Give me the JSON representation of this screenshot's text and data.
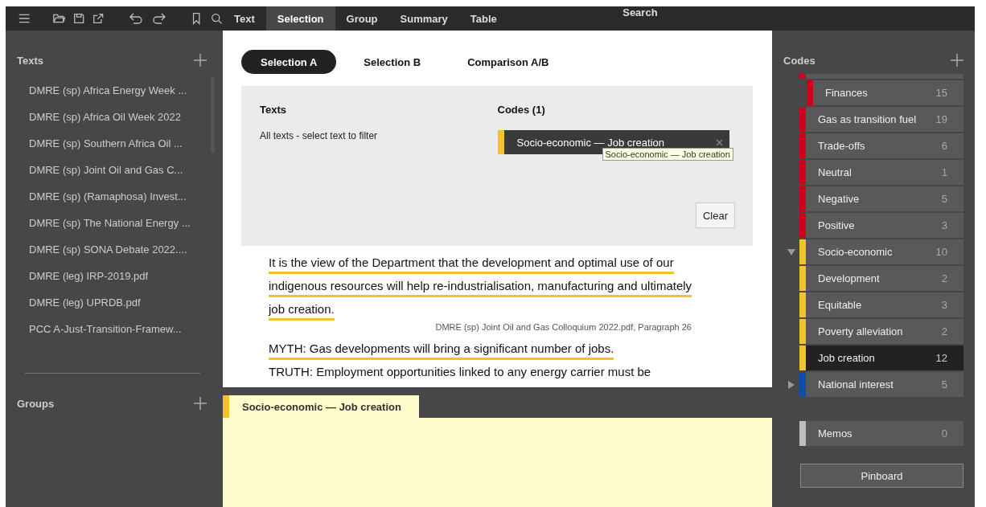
{
  "toolbar": {
    "tabs": [
      {
        "label": "Text",
        "selected": false
      },
      {
        "label": "Selection",
        "selected": true
      },
      {
        "label": "Group",
        "selected": false
      },
      {
        "label": "Summary",
        "selected": false
      },
      {
        "label": "Table",
        "selected": false
      }
    ],
    "search_tab": {
      "label": "Search",
      "selected": false
    }
  },
  "texts_panel": {
    "title": "Texts",
    "items": [
      "DMRE (sp) Africa Energy Week ...",
      "DMRE (sp) Africa Oil Week 2022",
      "DMRE (sp) Southern Africa Oil ...",
      "DMRE (sp) Joint Oil and Gas C...",
      "DMRE (sp) (Ramaphosa) Invest...",
      "DMRE (sp) The National Energy ...",
      "DMRE (sp) SONA Debate 2022....",
      "DMRE (leg) IRP-2019.pdf",
      "DMRE (leg) UPRDB.pdf",
      "PCC A-Just-Transition-Framew..."
    ]
  },
  "groups_panel": {
    "title": "Groups"
  },
  "selection_tabs": [
    {
      "label": "Selection A",
      "selected": true
    },
    {
      "label": "Selection B",
      "selected": false
    },
    {
      "label": "Comparison A/B",
      "selected": false
    }
  ],
  "filter": {
    "texts_title": "Texts",
    "texts_hint": "All texts - select text to filter",
    "codes_title": "Codes (1)",
    "codes": [
      {
        "label": "Socio-economic — Job creation",
        "color": "#f2c12e",
        "tooltip": "Socio-economic — Job creation"
      }
    ],
    "clear_button": "Clear"
  },
  "passages": [
    {
      "text": "It is the view of the Department that the development and optimal use of our indigenous resources will help re-industrialisation, manufacturing and ultimately job creation.",
      "coded": true,
      "source": "DMRE (sp) Joint Oil and Gas Colloquium 2022.pdf, Paragraph 26"
    },
    {
      "text": "MYTH: Gas developments will bring a significant number of jobs.",
      "coded": true
    },
    {
      "text": "TRUTH: Employment opportunities linked to any energy carrier must be",
      "coded": false
    }
  ],
  "memo_tab": {
    "label": "Socio-economic — Job creation",
    "color": "#f2c12e"
  },
  "codes_panel": {
    "title": "Codes",
    "codes": [
      {
        "kind": "hidden",
        "children": [
          {
            "kind": "cut",
            "color": "#d0021b",
            "children": [
              {
                "kind": "code",
                "label": "Finances",
                "count": "15",
                "color": "#d0021b",
                "selected": false
              }
            ]
          },
          {
            "kind": "code",
            "label": "Gas as transition fuel",
            "count": "19",
            "color": "#d0021b",
            "selected": false
          },
          {
            "kind": "code",
            "label": "Trade-offs",
            "count": "6",
            "color": "#d0021b",
            "selected": false
          },
          {
            "kind": "code",
            "label": "Neutral",
            "count": "1",
            "color": "#d0021b",
            "selected": false
          },
          {
            "kind": "code",
            "label": "Negative",
            "count": "5",
            "color": "#d0021b",
            "selected": false
          },
          {
            "kind": "code",
            "label": "Positive",
            "count": "3",
            "color": "#d0021b",
            "selected": false
          }
        ]
      },
      {
        "kind": "code",
        "label": "Socio-economic",
        "count": "10",
        "color": "#f2c12e",
        "selected": false,
        "expanded": true,
        "children": [
          {
            "kind": "code",
            "label": "Development",
            "count": "2",
            "color": "#f2c12e",
            "selected": false
          },
          {
            "kind": "code",
            "label": "Equitable",
            "count": "3",
            "color": "#f2c12e",
            "selected": false
          },
          {
            "kind": "code",
            "label": "Poverty alleviation",
            "count": "2",
            "color": "#f2c12e",
            "selected": false
          },
          {
            "kind": "code",
            "label": "Job creation",
            "count": "12",
            "color": "#f2c12e",
            "selected": true
          }
        ]
      },
      {
        "kind": "code",
        "label": "National interest",
        "count": "5",
        "color": "#0b4fa8",
        "selected": false,
        "expanded": false
      }
    ],
    "memos": {
      "label": "Memos",
      "count": "0",
      "color": "#bdbdbd"
    },
    "pinboard_button": "Pinboard"
  }
}
